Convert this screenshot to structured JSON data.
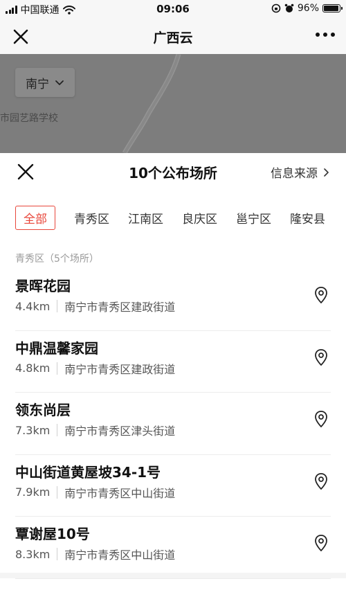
{
  "status_bar": {
    "carrier": "中国联通",
    "time": "09:06",
    "battery": "96%",
    "battery_level": 0.96
  },
  "nav": {
    "title": "广西云",
    "icons": [
      "close-icon",
      "more-icon"
    ]
  },
  "map": {
    "city": "南宁",
    "label": "市园艺路学校"
  },
  "sheet": {
    "title": "10个公布场所",
    "info_source": "信息来源"
  },
  "tabs": [
    {
      "label": "全部",
      "active": true
    },
    {
      "label": "青秀区",
      "active": false
    },
    {
      "label": "江南区",
      "active": false
    },
    {
      "label": "良庆区",
      "active": false
    },
    {
      "label": "邕宁区",
      "active": false
    },
    {
      "label": "隆安县",
      "active": false
    }
  ],
  "section": {
    "header": "青秀区（5个场所）"
  },
  "places": [
    {
      "name": "景晖花园",
      "distance": "4.4km",
      "address": "南宁市青秀区建政街道"
    },
    {
      "name": "中鼎温馨家园",
      "distance": "4.8km",
      "address": "南宁市青秀区建政街道"
    },
    {
      "name": "领东尚层",
      "distance": "7.3km",
      "address": "南宁市青秀区津头街道"
    },
    {
      "name": "中山街道黄屋坡34-1号",
      "distance": "7.9km",
      "address": "南宁市青秀区中山街道"
    },
    {
      "name": "覃谢屋10号",
      "distance": "8.3km",
      "address": "南宁市青秀区中山街道"
    }
  ],
  "colors": {
    "accent": "#e8463a",
    "map_overlay": "#7d7d7d"
  }
}
